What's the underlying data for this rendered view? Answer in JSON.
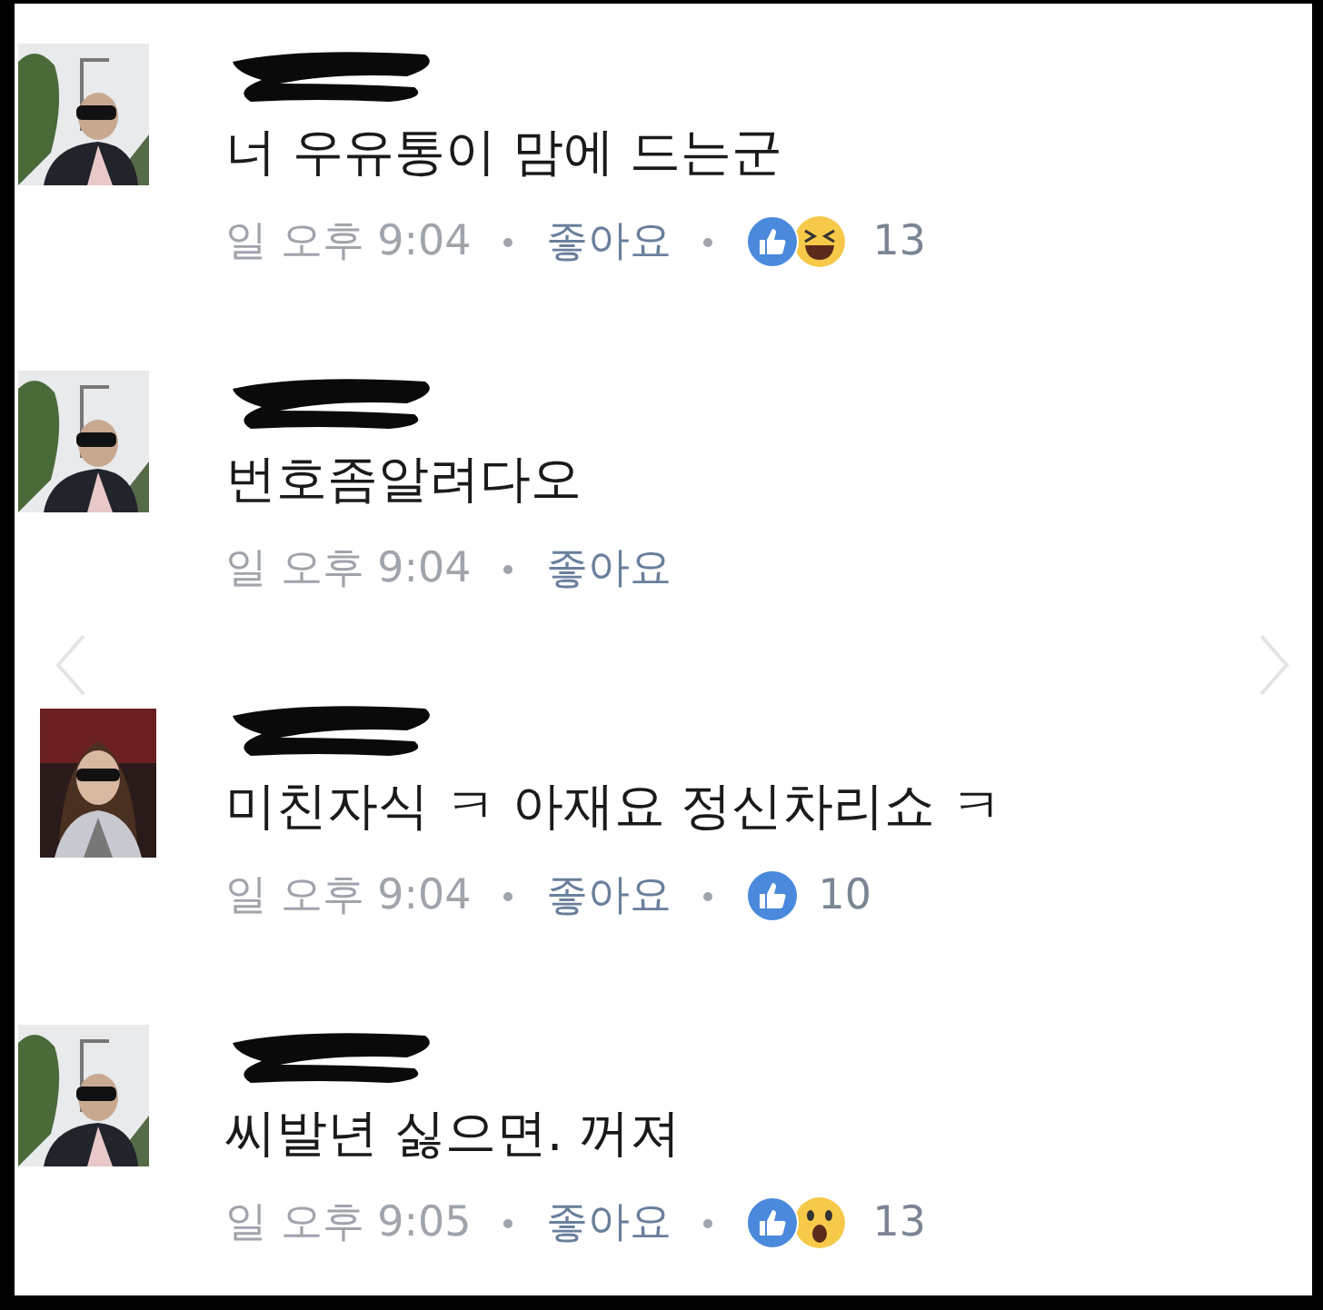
{
  "comments": [
    {
      "text": "너 우유통이 맘에 드는군",
      "time": "일 오후 9:04",
      "like_label": "좋아요",
      "reactions": [
        {
          "kind": "like"
        },
        {
          "kind": "haha"
        }
      ],
      "count": "13"
    },
    {
      "text": "번호좀알려다오",
      "time": "일 오후 9:04",
      "like_label": "좋아요"
    },
    {
      "text": "미친자식 ㅋ 아재요 정신차리쇼 ㅋ",
      "time": "일 오후 9:04",
      "like_label": "좋아요",
      "reactions": [
        {
          "kind": "like"
        }
      ],
      "count": "10"
    },
    {
      "text": "씨발년 싫으면. 꺼져",
      "time": "일 오후 9:05",
      "like_label": "좋아요",
      "reactions": [
        {
          "kind": "like"
        },
        {
          "kind": "wow"
        }
      ],
      "count": "13"
    }
  ]
}
